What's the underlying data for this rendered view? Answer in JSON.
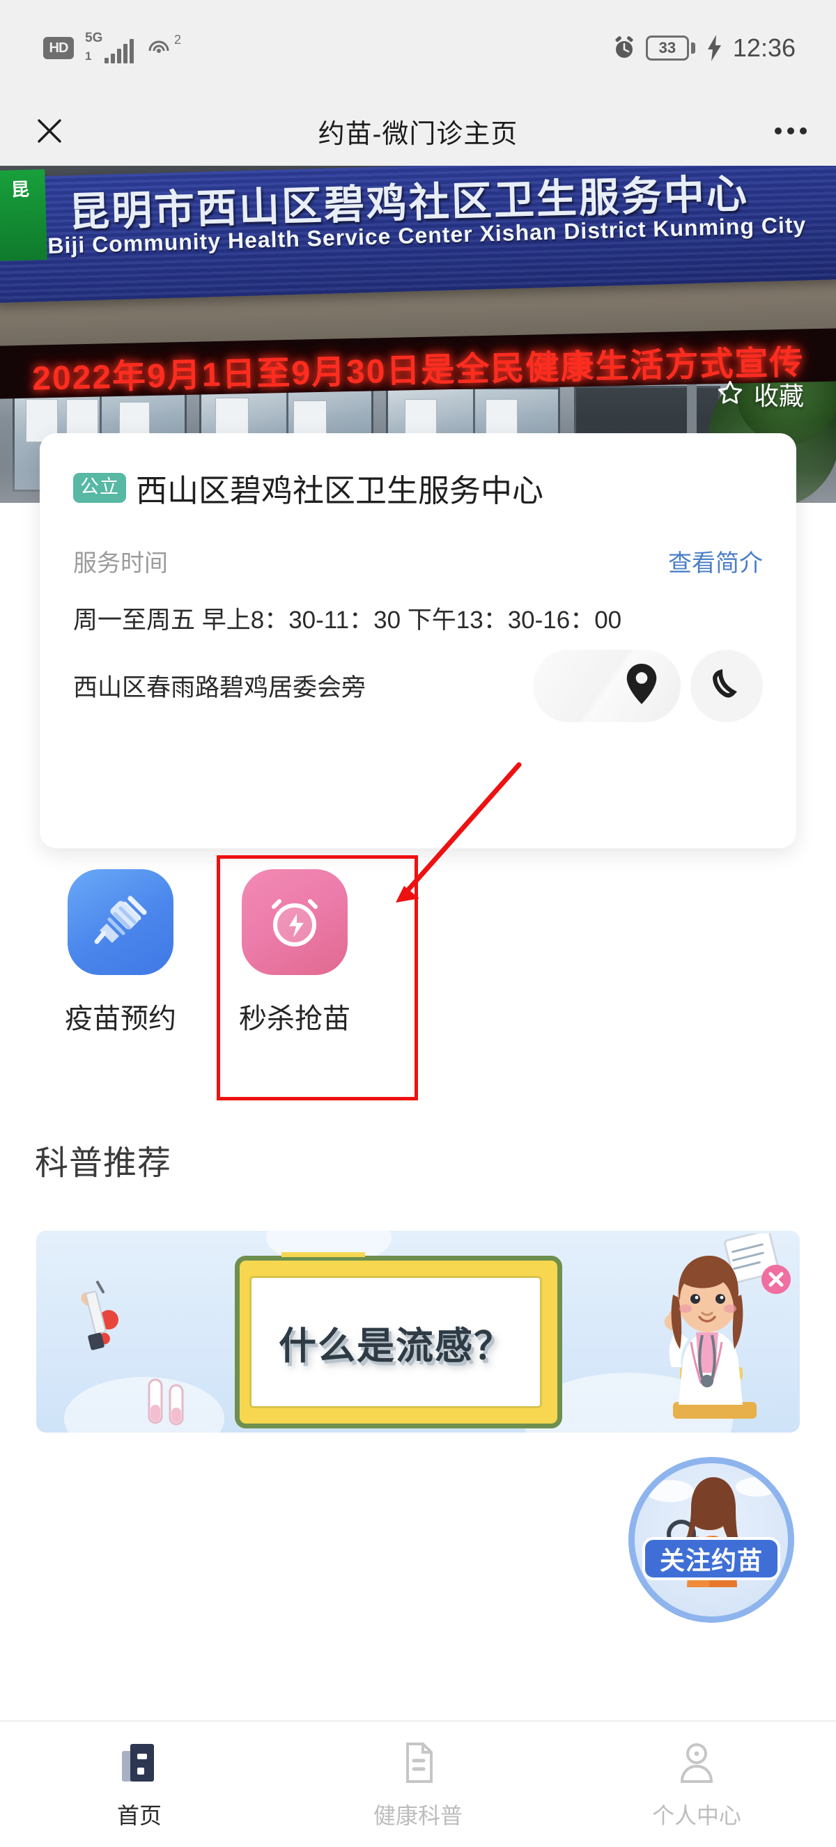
{
  "statusbar": {
    "hd": "HD",
    "network": "5G",
    "network_sub": "1",
    "wifi_sup": "2",
    "battery": "33",
    "time": "12:36",
    "icons": {
      "alarm": "alarm-clock-icon",
      "charging": "charging-bolt-icon",
      "signal": "signal-bars-icon",
      "hotspot": "hotspot-icon"
    }
  },
  "navbar": {
    "title": "约苗-微门诊主页",
    "close_icon": "close-icon",
    "more_icon": "more-options-icon"
  },
  "hero": {
    "sign_cn": "昆明市西山区碧鸡社区卫生服务中心",
    "sign_en": "Biji Community Health Service Center Xishan District Kunming City",
    "green_logo": "昆",
    "led_text": "2022年9月1日至9月30日是全民健康生活方式宣传",
    "favorite_label": "收藏",
    "favorite_icon": "star-outline-icon"
  },
  "clinic": {
    "badge": "公立",
    "name": "西山区碧鸡社区卫生服务中心",
    "hours_label": "服务时间",
    "intro_link": "查看简介",
    "hours_value": "周一至周五 早上8：30-11：30 下午13：30-16：00",
    "address": "西山区春雨路碧鸡居委会旁",
    "map_icon": "location-pin-icon",
    "phone_icon": "phone-icon"
  },
  "actions": [
    {
      "label": "疫苗预约",
      "icon": "syringe-icon",
      "color": "#4a86ec"
    },
    {
      "label": "秒杀抢苗",
      "icon": "alarm-flash-icon",
      "color": "#ec7ba9"
    }
  ],
  "science": {
    "section_title": "科普推荐",
    "banner_text": "什么是流感？",
    "banner_alt_icons": [
      "syringe-icon",
      "test-tube-icon",
      "clipboard-icon",
      "doctor-character"
    ]
  },
  "float_badge": {
    "text": "关注约苗",
    "icon": "follow-youmiao-badge"
  },
  "annotation": {
    "box_color": "#ee1111",
    "arrow_color": "#ee1111",
    "target": "秒杀抢苗"
  },
  "tabbar": [
    {
      "label": "首页",
      "icon": "home-icon",
      "active": true
    },
    {
      "label": "健康科普",
      "icon": "document-icon",
      "active": false
    },
    {
      "label": "个人中心",
      "icon": "person-icon",
      "active": false
    }
  ]
}
